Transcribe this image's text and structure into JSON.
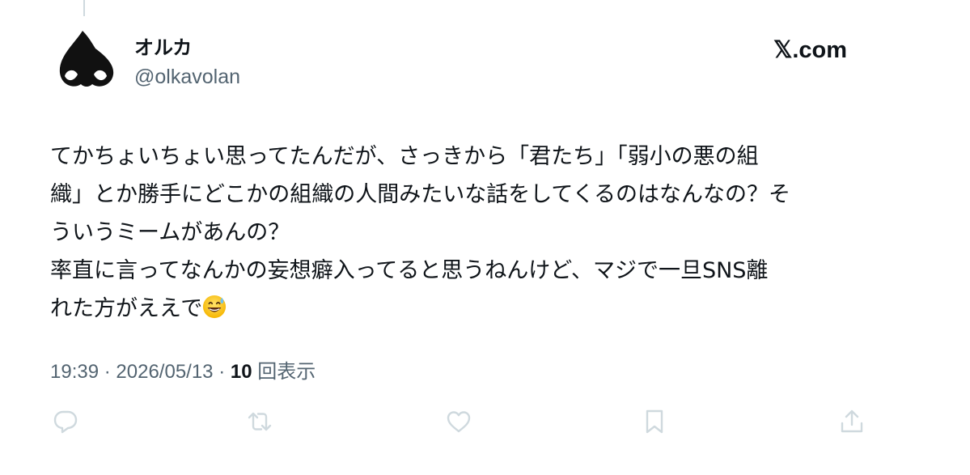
{
  "author": {
    "display_name": "オルカ",
    "handle": "@olkavolan",
    "avatar_icon": "orca-avatar-icon"
  },
  "brand": {
    "label": "𝕏.com"
  },
  "tweet": {
    "lines": [
      "てかちょいちょい思ってたんだが、さっきから「君たち」「弱小の悪の組",
      "織」とか勝手にどこかの組織の人間みたいな話をしてくるのはなんなの？そ",
      "ういうミームがあんの？",
      "率直に言ってなんかの妄想癖入ってると思うねんけど、マジで一旦SNS離",
      "れた方がええで"
    ],
    "emoji": "grinning-face-with-sweat-emoji"
  },
  "meta": {
    "time": "19:39",
    "separator": "·",
    "date": "2026/05/13",
    "views_count": "10",
    "views_label": "回表示"
  },
  "actions": {
    "icons": [
      "reply-icon",
      "retweet-icon",
      "like-icon",
      "bookmark-icon",
      "share-icon"
    ]
  },
  "colors": {
    "text_primary": "#0f1419",
    "text_secondary": "#536471",
    "icon_gray": "#cfd9de"
  }
}
